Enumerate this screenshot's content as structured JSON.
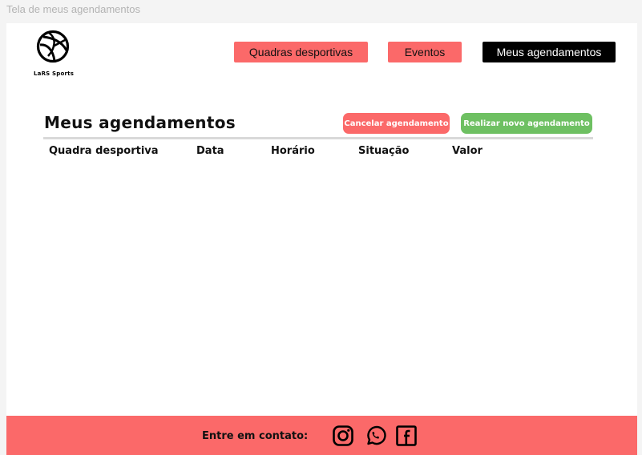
{
  "frame": {
    "label": "Tela de meus agendamentos"
  },
  "brand": {
    "name": "LaRS Sports"
  },
  "nav": {
    "items": [
      {
        "label": "Quadras desportivas",
        "active": false
      },
      {
        "label": "Eventos",
        "active": false
      },
      {
        "label": "Meus agendamentos",
        "active": true
      }
    ]
  },
  "main": {
    "title": "Meus agendamentos",
    "cancel_label": "Cancelar agendamento",
    "new_label": "Realizar novo agendamento",
    "columns": [
      "Quadra desportiva",
      "Data",
      "Horário",
      "Situação",
      "Valor"
    ],
    "rows": []
  },
  "footer": {
    "contact_label": "Entre em contato:",
    "social": [
      "instagram-icon",
      "whatsapp-icon",
      "facebook-icon"
    ]
  },
  "colors": {
    "accent_red": "#fb6969",
    "accent_green": "#6ec062",
    "active_nav": "#000000"
  }
}
